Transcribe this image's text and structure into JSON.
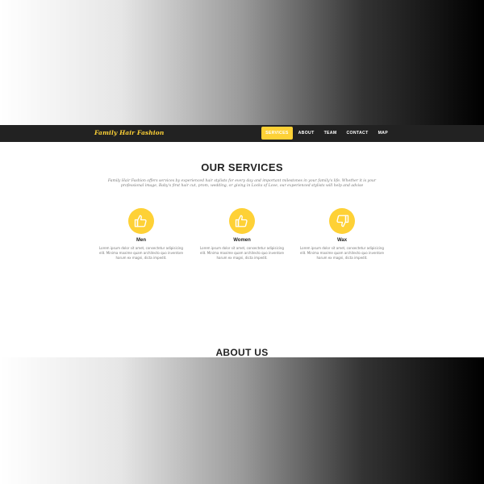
{
  "navbar": {
    "brand": "Family Hair Fashion",
    "links": [
      {
        "label": "SERVICES",
        "active": true
      },
      {
        "label": "ABOUT",
        "active": false
      },
      {
        "label": "TEAM",
        "active": false
      },
      {
        "label": "CONTACT",
        "active": false
      },
      {
        "label": "MAP",
        "active": false
      }
    ]
  },
  "services": {
    "title": "OUR SERVICES",
    "subtitle": "Family Hair Fashion offers services by experienced hair stylists for every day and important milestones in your family's life. Whether it is your professional image, Baby's first hair cut, prom, wedding, or giving in Locks of Love, our experienced stylists will help and advise",
    "items": [
      {
        "heading": "Men",
        "icon": "thumbs-up-icon",
        "text": "Lorem ipsum dolor sit amet, consectetur adipisicing elit. Minima maxime quam architecto quo inventore harum ex magni, dicta impedit."
      },
      {
        "heading": "Women",
        "icon": "thumbs-up-icon",
        "text": "Lorem ipsum dolor sit amet, consectetur adipisicing elit. Minima maxime quam architecto quo inventore harum ex magni, dicta impedit."
      },
      {
        "heading": "Wax",
        "icon": "thumbs-down-icon",
        "text": "Lorem ipsum dolor sit amet, consectetur adipisicing elit. Minima maxime quam architecto quo inventore harum ex magni, dicta impedit."
      }
    ]
  },
  "about": {
    "title": "ABOUT US"
  },
  "colors": {
    "accent": "#fed136",
    "navbar": "#222222",
    "heading": "#222222",
    "muted": "#777777"
  }
}
